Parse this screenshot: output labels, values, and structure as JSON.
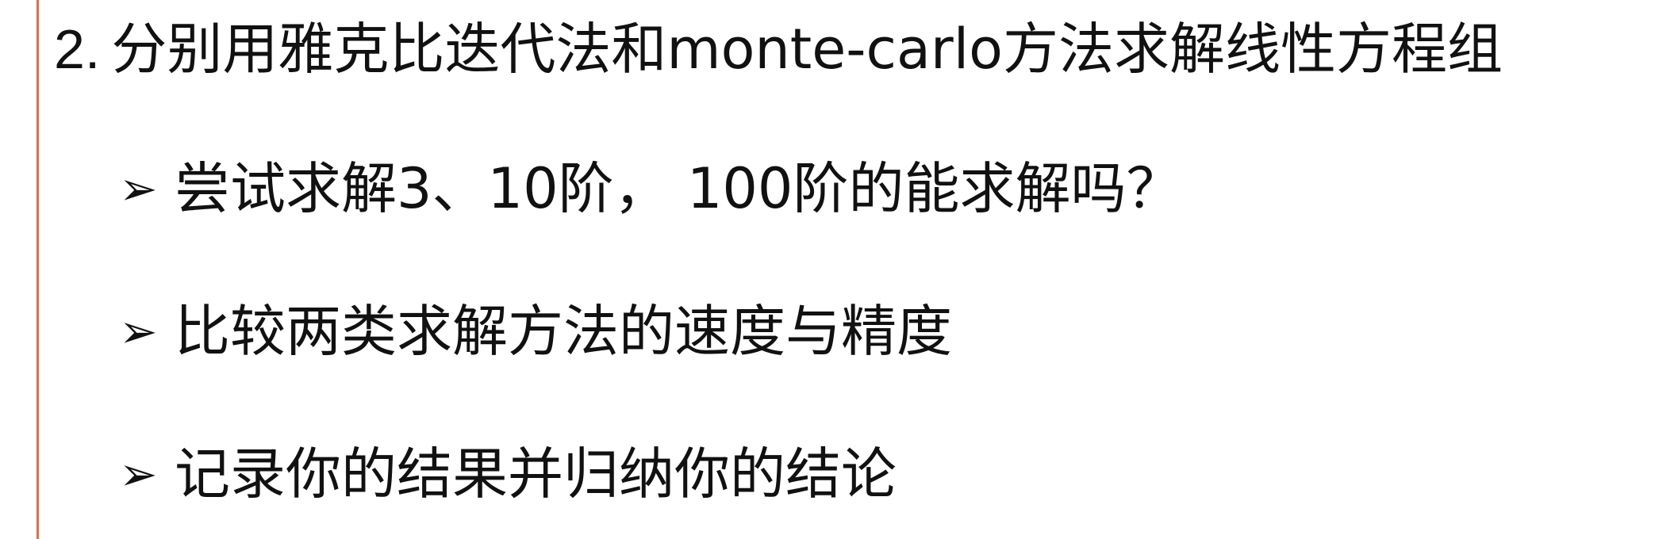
{
  "heading": {
    "number": "2.",
    "text": "分别用雅克比迭代法和monte-carlo方法求解线性方程组"
  },
  "bullets": [
    {
      "marker": "➢",
      "text": "尝试求解3、10阶， 100阶的能求解吗？"
    },
    {
      "marker": "➢",
      "text": "比较两类求解方法的速度与精度"
    },
    {
      "marker": "➢",
      "text": "记录你的结果并归纳你的结论"
    }
  ],
  "colors": {
    "accent_rule": "#d9704f",
    "text": "#111111",
    "background": "#ffffff"
  }
}
